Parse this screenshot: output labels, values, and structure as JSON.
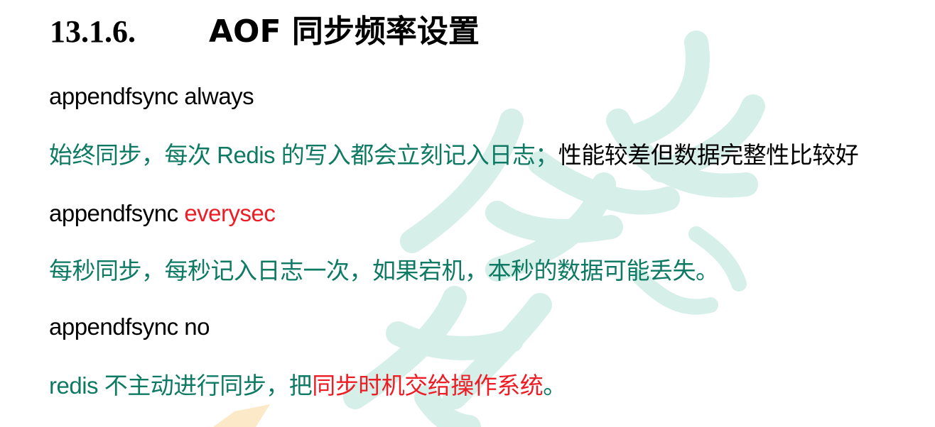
{
  "heading": {
    "number": "13.1.6.",
    "title": "AOF 同步频率设置"
  },
  "lines": {
    "line1": {
      "text": "appendfsync always"
    },
    "line2": {
      "green_part": "始终同步，每次 Redis 的写入都会立刻记入日志；",
      "black_part": "性能较差但数据完整性比较好"
    },
    "line3": {
      "black_part": "appendfsync ",
      "red_part": "everysec"
    },
    "line4": {
      "text": "每秒同步，每秒记入日志一次，如果宕机，本秒的数据可能丢失。"
    },
    "line5": {
      "text": "appendfsync no"
    },
    "line6": {
      "green_part": "redis 不主动进行同步，把",
      "red_part": "同步时机交给操作系统",
      "green_end": "。"
    }
  },
  "colors": {
    "green_text": "#0e7a63",
    "red_text": "#ee1c25",
    "black_text": "#000000",
    "watermark_teal": "#d6efe9",
    "watermark_orange": "#fce9c8"
  }
}
